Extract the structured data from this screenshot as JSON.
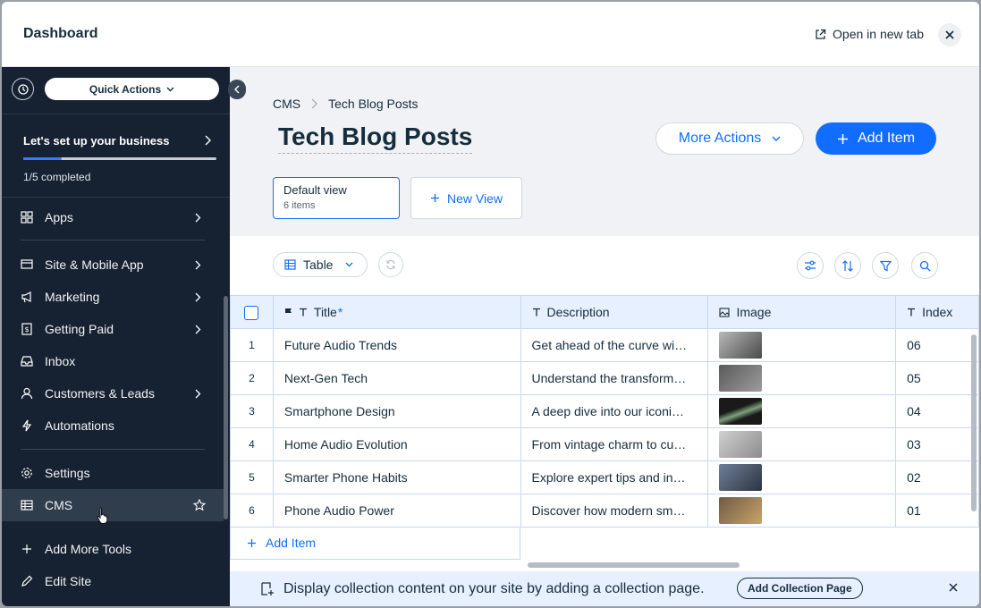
{
  "topbar": {
    "title": "Dashboard",
    "open_tab": "Open in new tab"
  },
  "sidebar": {
    "quick_actions": "Quick Actions",
    "setup": {
      "title": "Let's set up your business",
      "progress_text": "1/5 completed",
      "progress": 0.2
    },
    "items": [
      {
        "label": "Apps",
        "icon": "apps-icon",
        "arrow": true
      },
      {
        "label": "Site & Mobile App",
        "icon": "site-icon",
        "arrow": true
      },
      {
        "label": "Marketing",
        "icon": "megaphone-icon",
        "arrow": true
      },
      {
        "label": "Getting Paid",
        "icon": "payment-icon",
        "arrow": true
      },
      {
        "label": "Inbox",
        "icon": "inbox-icon",
        "arrow": false
      },
      {
        "label": "Customers & Leads",
        "icon": "customers-icon",
        "arrow": true
      },
      {
        "label": "Automations",
        "icon": "lightning-icon",
        "arrow": false
      },
      {
        "label": "Settings",
        "icon": "gear-icon",
        "arrow": false
      },
      {
        "label": "CMS",
        "icon": "cms-icon",
        "arrow": false
      },
      {
        "label": "Add More Tools",
        "icon": "plus-icon",
        "arrow": false
      },
      {
        "label": "Edit Site",
        "icon": "pencil-icon",
        "arrow": false
      }
    ]
  },
  "main": {
    "breadcrumb": {
      "root": "CMS",
      "current": "Tech Blog Posts"
    },
    "title": "Tech Blog Posts",
    "more_actions": "More Actions",
    "add_item": "Add Item",
    "view": {
      "name": "Default view",
      "count": "6 items"
    },
    "new_view": "New View",
    "table_mode": "Table",
    "columns": [
      "Title",
      "Description",
      "Image",
      "Index"
    ],
    "rows": [
      {
        "n": "1",
        "title": "Future Audio Trends",
        "description": "Get ahead of the curve with the latest audio trends",
        "index": "06",
        "img": [
          "#b8b8b8",
          "#4a4a4a"
        ]
      },
      {
        "n": "2",
        "title": "Next-Gen Tech",
        "description": "Understand the transformative power of next-gen tech",
        "index": "05",
        "img": [
          "#5a5a5a",
          "#9c9c9c"
        ]
      },
      {
        "n": "3",
        "title": "Smartphone Design",
        "description": "A deep dive into our iconic smartphone design",
        "index": "04",
        "img": [
          "#1a1a1a",
          "#7fa07a"
        ]
      },
      {
        "n": "4",
        "title": "Home Audio Evolution",
        "description": "From vintage charm to cutting-edge home audio",
        "index": "03",
        "img": [
          "#d0d0d0",
          "#8c8c8c"
        ]
      },
      {
        "n": "5",
        "title": "Smarter Phone Habits",
        "description": "Explore expert tips and insights for smarter phone habits",
        "index": "02",
        "img": [
          "#6f7f96",
          "#2c3444"
        ]
      },
      {
        "n": "6",
        "title": "Phone Audio Power",
        "description": "Discover how modern smartphones deliver audio power",
        "index": "01",
        "img": [
          "#6e5a44",
          "#c9a46a"
        ]
      }
    ],
    "add_item_row": "Add Item",
    "banner": {
      "text": "Display collection content on your site by adding a collection page.",
      "button": "Add Collection Page"
    }
  },
  "colors": {
    "accent": "#116dff",
    "sidebar": "#162231",
    "header_row": "#e7f0ff"
  }
}
